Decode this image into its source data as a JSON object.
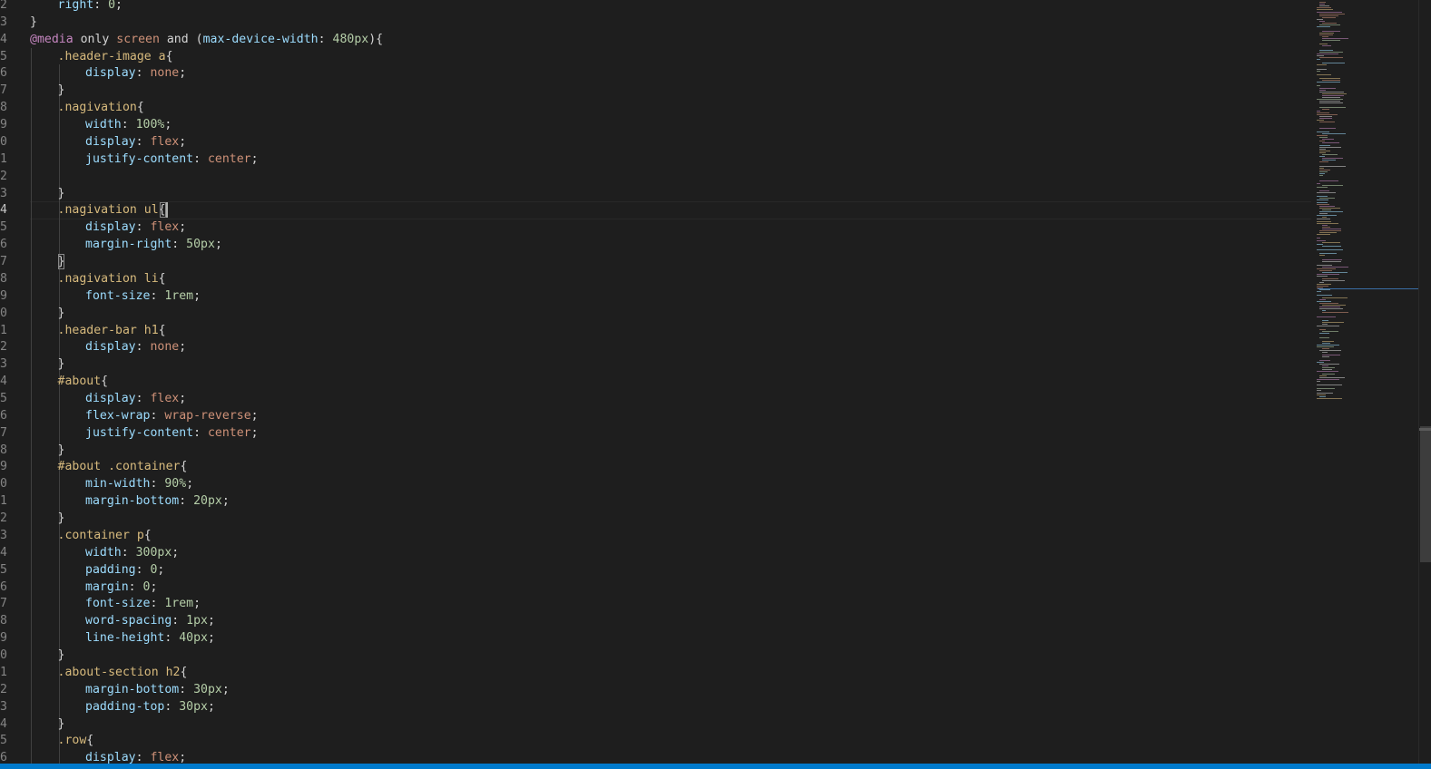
{
  "editor": {
    "language": "css",
    "cursor_line_number": "4",
    "colors": {
      "background": "#1e1e1e",
      "at_rule": "#c586c0",
      "selector": "#d7ba7d",
      "property": "#9cdcfe",
      "value": "#ce9178",
      "number": "#b5cea8",
      "punctuation": "#d4d4d4",
      "status_bar": "#007acc"
    }
  },
  "lines": [
    {
      "num": "2",
      "indent": 1,
      "tokens": [
        [
          "prop",
          "right"
        ],
        [
          "punc",
          ": "
        ],
        [
          "num",
          "0"
        ],
        [
          "punc",
          ";"
        ]
      ]
    },
    {
      "num": "3",
      "indent": 0,
      "tokens": [
        [
          "punc",
          "}"
        ]
      ]
    },
    {
      "num": "4",
      "indent": 0,
      "tokens": [
        [
          "at",
          "@media"
        ],
        [
          "kw",
          " only "
        ],
        [
          "media",
          "screen"
        ],
        [
          "kw",
          " and "
        ],
        [
          "punc",
          "("
        ],
        [
          "prop",
          "max-device-width"
        ],
        [
          "punc",
          ": "
        ],
        [
          "num",
          "480px"
        ],
        [
          "punc",
          "){"
        ]
      ]
    },
    {
      "num": "5",
      "indent": 1,
      "tokens": [
        [
          "sel",
          ".header-image a"
        ],
        [
          "punc",
          "{"
        ]
      ]
    },
    {
      "num": "6",
      "indent": 2,
      "tokens": [
        [
          "prop",
          "display"
        ],
        [
          "punc",
          ": "
        ],
        [
          "val",
          "none"
        ],
        [
          "punc",
          ";"
        ]
      ]
    },
    {
      "num": "7",
      "indent": 1,
      "tokens": [
        [
          "punc",
          "}"
        ]
      ]
    },
    {
      "num": "8",
      "indent": 1,
      "tokens": [
        [
          "sel",
          ".nagivation"
        ],
        [
          "punc",
          "{"
        ]
      ]
    },
    {
      "num": "9",
      "indent": 2,
      "tokens": [
        [
          "prop",
          "width"
        ],
        [
          "punc",
          ": "
        ],
        [
          "num",
          "100%"
        ],
        [
          "punc",
          ";"
        ]
      ]
    },
    {
      "num": "0",
      "indent": 2,
      "tokens": [
        [
          "prop",
          "display"
        ],
        [
          "punc",
          ": "
        ],
        [
          "val",
          "flex"
        ],
        [
          "punc",
          ";"
        ]
      ]
    },
    {
      "num": "1",
      "indent": 2,
      "tokens": [
        [
          "prop",
          "justify-content"
        ],
        [
          "punc",
          ": "
        ],
        [
          "val",
          "center"
        ],
        [
          "punc",
          ";"
        ]
      ]
    },
    {
      "num": "2",
      "indent": 0,
      "tokens": []
    },
    {
      "num": "3",
      "indent": 1,
      "tokens": [
        [
          "punc",
          "}"
        ]
      ]
    },
    {
      "num": "4",
      "indent": 1,
      "active": true,
      "tokens": [
        [
          "sel",
          ".nagivation ul"
        ],
        [
          "punc",
          "{"
        ]
      ]
    },
    {
      "num": "5",
      "indent": 2,
      "tokens": [
        [
          "prop",
          "display"
        ],
        [
          "punc",
          ": "
        ],
        [
          "val",
          "flex"
        ],
        [
          "punc",
          ";"
        ]
      ]
    },
    {
      "num": "6",
      "indent": 2,
      "tokens": [
        [
          "prop",
          "margin-right"
        ],
        [
          "punc",
          ": "
        ],
        [
          "num",
          "50px"
        ],
        [
          "punc",
          ";"
        ]
      ]
    },
    {
      "num": "7",
      "indent": 1,
      "tokens": [
        [
          "punc",
          "}"
        ]
      ]
    },
    {
      "num": "8",
      "indent": 1,
      "tokens": [
        [
          "sel",
          ".nagivation li"
        ],
        [
          "punc",
          "{"
        ]
      ]
    },
    {
      "num": "9",
      "indent": 2,
      "tokens": [
        [
          "prop",
          "font-size"
        ],
        [
          "punc",
          ": "
        ],
        [
          "num",
          "1rem"
        ],
        [
          "punc",
          ";"
        ]
      ]
    },
    {
      "num": "0",
      "indent": 1,
      "tokens": [
        [
          "punc",
          "}"
        ]
      ]
    },
    {
      "num": "1",
      "indent": 1,
      "tokens": [
        [
          "sel",
          ".header-bar h1"
        ],
        [
          "punc",
          "{"
        ]
      ]
    },
    {
      "num": "2",
      "indent": 2,
      "tokens": [
        [
          "prop",
          "display"
        ],
        [
          "punc",
          ": "
        ],
        [
          "val",
          "none"
        ],
        [
          "punc",
          ";"
        ]
      ]
    },
    {
      "num": "3",
      "indent": 1,
      "tokens": [
        [
          "punc",
          "}"
        ]
      ]
    },
    {
      "num": "4",
      "indent": 1,
      "tokens": [
        [
          "sel",
          "#about"
        ],
        [
          "punc",
          "{"
        ]
      ]
    },
    {
      "num": "5",
      "indent": 2,
      "tokens": [
        [
          "prop",
          "display"
        ],
        [
          "punc",
          ": "
        ],
        [
          "val",
          "flex"
        ],
        [
          "punc",
          ";"
        ]
      ]
    },
    {
      "num": "6",
      "indent": 2,
      "tokens": [
        [
          "prop",
          "flex-wrap"
        ],
        [
          "punc",
          ": "
        ],
        [
          "val",
          "wrap-reverse"
        ],
        [
          "punc",
          ";"
        ]
      ]
    },
    {
      "num": "7",
      "indent": 2,
      "tokens": [
        [
          "prop",
          "justify-content"
        ],
        [
          "punc",
          ": "
        ],
        [
          "val",
          "center"
        ],
        [
          "punc",
          ";"
        ]
      ]
    },
    {
      "num": "8",
      "indent": 1,
      "tokens": [
        [
          "punc",
          "}"
        ]
      ]
    },
    {
      "num": "9",
      "indent": 1,
      "tokens": [
        [
          "sel",
          "#about .container"
        ],
        [
          "punc",
          "{"
        ]
      ]
    },
    {
      "num": "0",
      "indent": 2,
      "tokens": [
        [
          "prop",
          "min-width"
        ],
        [
          "punc",
          ": "
        ],
        [
          "num",
          "90%"
        ],
        [
          "punc",
          ";"
        ]
      ]
    },
    {
      "num": "1",
      "indent": 2,
      "tokens": [
        [
          "prop",
          "margin-bottom"
        ],
        [
          "punc",
          ": "
        ],
        [
          "num",
          "20px"
        ],
        [
          "punc",
          ";"
        ]
      ]
    },
    {
      "num": "2",
      "indent": 1,
      "tokens": [
        [
          "punc",
          "}"
        ]
      ]
    },
    {
      "num": "3",
      "indent": 1,
      "tokens": [
        [
          "sel",
          ".container p"
        ],
        [
          "punc",
          "{"
        ]
      ]
    },
    {
      "num": "4",
      "indent": 2,
      "tokens": [
        [
          "prop",
          "width"
        ],
        [
          "punc",
          ": "
        ],
        [
          "num",
          "300px"
        ],
        [
          "punc",
          ";"
        ]
      ]
    },
    {
      "num": "5",
      "indent": 2,
      "tokens": [
        [
          "prop",
          "padding"
        ],
        [
          "punc",
          ": "
        ],
        [
          "num",
          "0"
        ],
        [
          "punc",
          ";"
        ]
      ]
    },
    {
      "num": "6",
      "indent": 2,
      "tokens": [
        [
          "prop",
          "margin"
        ],
        [
          "punc",
          ": "
        ],
        [
          "num",
          "0"
        ],
        [
          "punc",
          ";"
        ]
      ]
    },
    {
      "num": "7",
      "indent": 2,
      "tokens": [
        [
          "prop",
          "font-size"
        ],
        [
          "punc",
          ": "
        ],
        [
          "num",
          "1rem"
        ],
        [
          "punc",
          ";"
        ]
      ]
    },
    {
      "num": "8",
      "indent": 2,
      "tokens": [
        [
          "prop",
          "word-spacing"
        ],
        [
          "punc",
          ": "
        ],
        [
          "num",
          "1px"
        ],
        [
          "punc",
          ";"
        ]
      ]
    },
    {
      "num": "9",
      "indent": 2,
      "tokens": [
        [
          "prop",
          "line-height"
        ],
        [
          "punc",
          ": "
        ],
        [
          "num",
          "40px"
        ],
        [
          "punc",
          ";"
        ]
      ]
    },
    {
      "num": "0",
      "indent": 1,
      "tokens": [
        [
          "punc",
          "}"
        ]
      ]
    },
    {
      "num": "1",
      "indent": 1,
      "tokens": [
        [
          "sel",
          ".about-section h2"
        ],
        [
          "punc",
          "{"
        ]
      ]
    },
    {
      "num": "2",
      "indent": 2,
      "tokens": [
        [
          "prop",
          "margin-bottom"
        ],
        [
          "punc",
          ": "
        ],
        [
          "num",
          "30px"
        ],
        [
          "punc",
          ";"
        ]
      ]
    },
    {
      "num": "3",
      "indent": 2,
      "tokens": [
        [
          "prop",
          "padding-top"
        ],
        [
          "punc",
          ": "
        ],
        [
          "num",
          "30px"
        ],
        [
          "punc",
          ";"
        ]
      ]
    },
    {
      "num": "4",
      "indent": 1,
      "tokens": [
        [
          "punc",
          "}"
        ]
      ]
    },
    {
      "num": "5",
      "indent": 1,
      "tokens": [
        [
          "sel",
          ".row"
        ],
        [
          "punc",
          "{"
        ]
      ]
    },
    {
      "num": "6",
      "indent": 2,
      "tokens": [
        [
          "prop",
          "display"
        ],
        [
          "punc",
          ": "
        ],
        [
          "val",
          "flex"
        ],
        [
          "punc",
          ";"
        ]
      ]
    }
  ]
}
